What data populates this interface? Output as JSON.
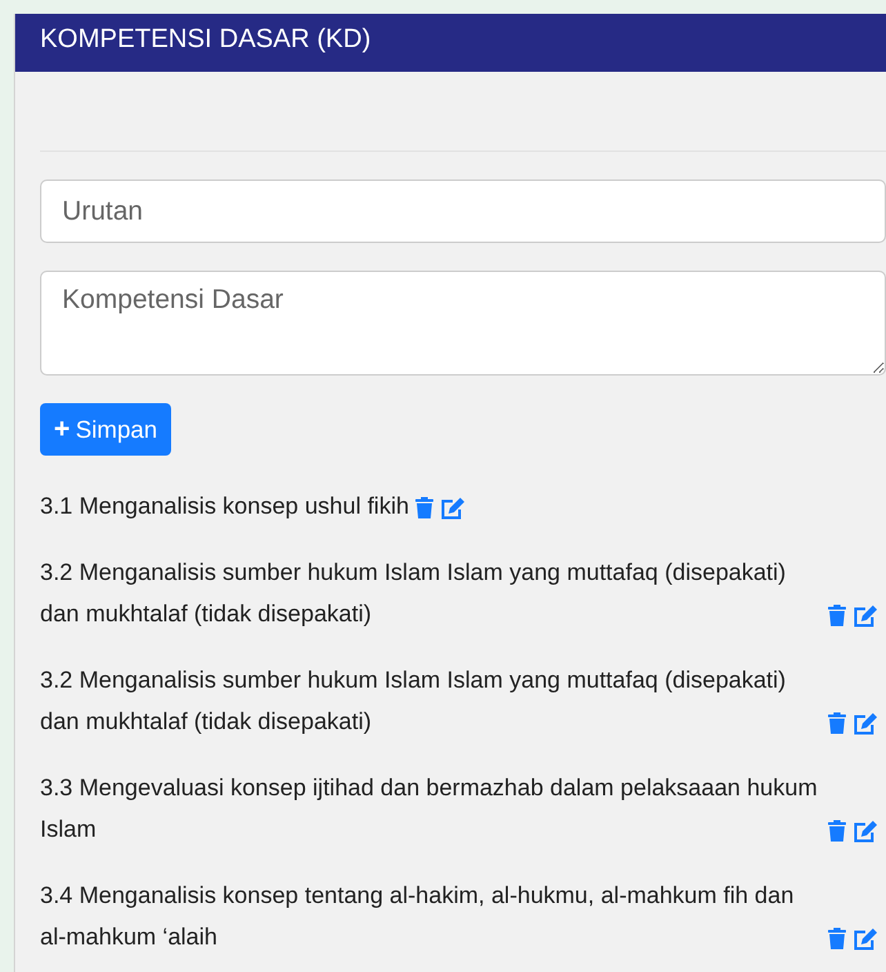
{
  "card": {
    "title": "KOMPETENSI DASAR (KD)"
  },
  "form": {
    "fields": [
      {
        "kind": "input",
        "placeholder": "Urutan"
      },
      {
        "kind": "textarea",
        "placeholder": "Kompetensi Dasar"
      }
    ],
    "submit": {
      "icon": "+",
      "label": "Simpan"
    }
  },
  "items": [
    {
      "text": "3.1 Menganalisis konsep ushul fikih"
    },
    {
      "text": "3.2 Menganalisis sumber hukum Islam Islam yang muttafaq (disepakati) dan mukhtalaf (tidak disepakati)"
    },
    {
      "text": "3.2 Menganalisis sumber hukum Islam Islam yang muttafaq (disepakati) dan mukhtalaf (tidak disepakati)"
    },
    {
      "text": "3.3 Mengevaluasi konsep ijtihad dan bermazhab dalam pelaksaaan hukum Islam"
    },
    {
      "text": "3.4 Menganalisis konsep tentang al-hakim, al-hukmu, al-mahkum fih dan al-mahkum ‘alaih"
    }
  ]
}
